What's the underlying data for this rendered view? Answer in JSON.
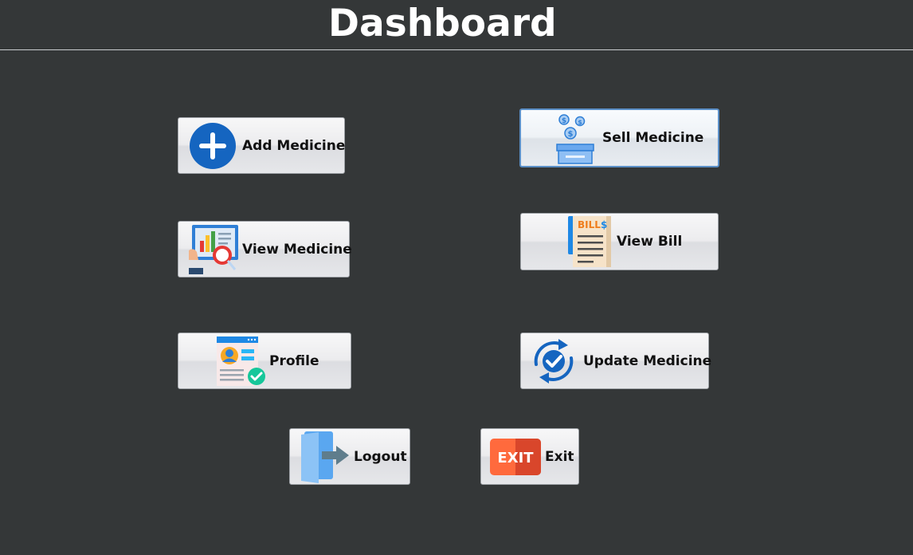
{
  "header": {
    "title": "Dashboard"
  },
  "buttons": {
    "add_medicine": {
      "label": "Add Medicine",
      "icon": "plus-circle-icon"
    },
    "sell_medicine": {
      "label": "Sell Medicine",
      "icon": "cash-box-icon"
    },
    "view_medicine": {
      "label": "View Medicine",
      "icon": "report-magnifier-icon"
    },
    "view_bill": {
      "label": "View Bill",
      "icon": "bill-icon"
    },
    "profile": {
      "label": "Profile",
      "icon": "profile-card-icon"
    },
    "update_medicine": {
      "label": "Update Medicine",
      "icon": "refresh-check-icon"
    },
    "logout": {
      "label": "Logout",
      "icon": "door-exit-icon"
    },
    "exit": {
      "label": "Exit",
      "icon": "exit-sign-icon"
    }
  },
  "bill_icon_text": {
    "word": "BILL",
    "symbol": "$"
  },
  "exit_icon_text": "EXIT",
  "colors": {
    "background": "#343738",
    "title": "#ffffff",
    "selected_border": "#5b8fc7",
    "primary_blue": "#1565c0"
  }
}
